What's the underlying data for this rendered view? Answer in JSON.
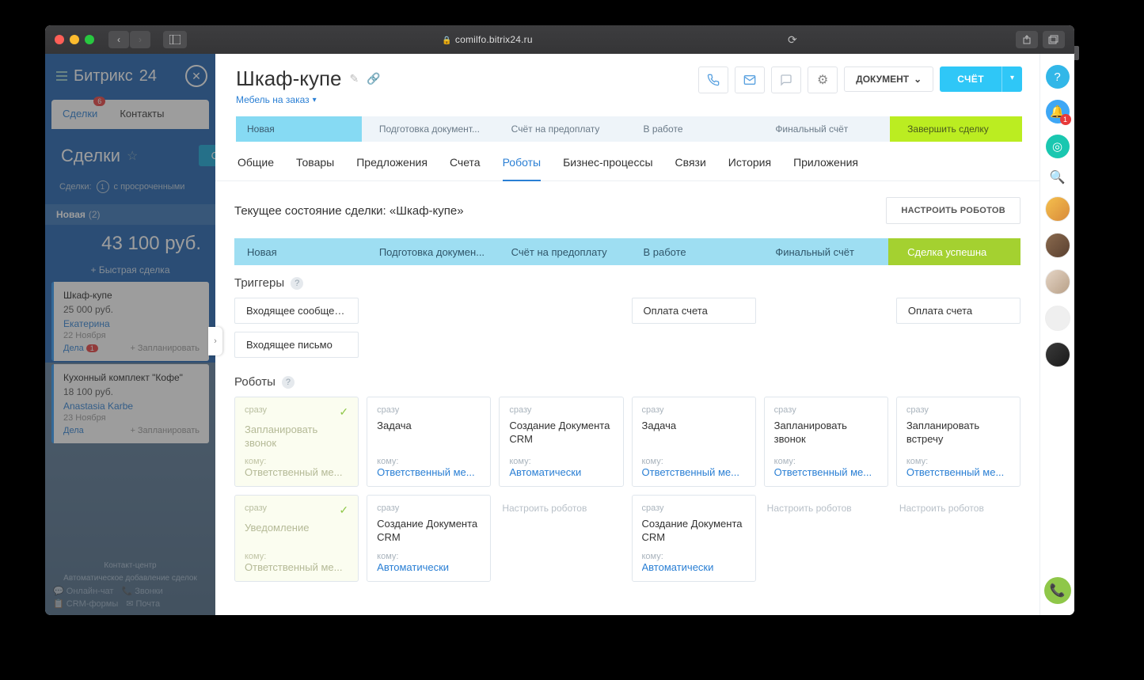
{
  "browser": {
    "url": "comilfo.bitrix24.ru"
  },
  "leftPane": {
    "logo1": "Битрикс",
    "logo2": "24",
    "tabs": [
      "Сделки",
      "Контакты"
    ],
    "tabBadge": "6",
    "sectionTitle": "Сделки",
    "filterPrefix": "Сделки:",
    "filterCount": "1",
    "filterText": "с просроченными",
    "stageName": "Новая",
    "stageCount": "(2)",
    "total": "43 100 руб.",
    "quickDeal": "Быстрая сделка",
    "deals": [
      {
        "title": "Шкаф-купе",
        "price": "25 000 руб.",
        "person": "Екатерина",
        "date": "22 Ноября",
        "dela": "Дела",
        "badge": "1",
        "plan": "+ Запланировать"
      },
      {
        "title": "Кухонный комплект \"Кофе\"",
        "price": "18 100 руб.",
        "person": "Anastasia Karbe",
        "date": "23 Ноября",
        "dela": "Дела",
        "badge": "",
        "plan": "+ Запланировать"
      }
    ],
    "cc1": "Контакт-центр",
    "cc2": "Автоматическое добавление сделок",
    "bl": [
      "Онлайн-чат",
      "Звонки",
      "CRM-формы",
      "Почта"
    ]
  },
  "header": {
    "title": "Шкаф-купе",
    "subtitle": "Мебель на заказ",
    "docBtn": "ДОКУМЕНТ",
    "billBtn": "СЧЁТ"
  },
  "pipeline": [
    "Новая",
    "Подготовка документ...",
    "Счёт на предоплату",
    "В работе",
    "Финальный счёт",
    "Завершить сделку"
  ],
  "tabs": [
    "Общие",
    "Товары",
    "Предложения",
    "Счета",
    "Роботы",
    "Бизнес-процессы",
    "Связи",
    "История",
    "Приложения"
  ],
  "activeTab": 4,
  "stateLabel": "Текущее состояние сделки: «Шкаф-купе»",
  "configureBtn": "НАСТРОИТЬ РОБОТОВ",
  "pipeline2": [
    "Новая",
    "Подготовка докумен...",
    "Счёт на предоплату",
    "В работе",
    "Финальный счёт",
    "Сделка успешна"
  ],
  "triggersLabel": "Триггеры",
  "triggers": [
    [
      "Входящее сообщени...",
      "Входящее письмо"
    ],
    [],
    [],
    [
      "Оплата счета"
    ],
    [],
    [
      "Оплата счета"
    ]
  ],
  "robotsLabel": "Роботы",
  "whenLabel": "сразу",
  "komuLabel": "кому:",
  "configureText": "Настроить роботов",
  "robots": [
    [
      {
        "done": true,
        "action": "Запланировать звонок",
        "resp": "Ответственный ме..."
      },
      {
        "done": true,
        "action": "Уведомление",
        "resp": "Ответственный ме..."
      }
    ],
    [
      {
        "done": false,
        "action": "Задача",
        "resp": "Ответственный ме..."
      },
      {
        "done": false,
        "action": "Создание Документа CRM",
        "resp": "Автоматически"
      }
    ],
    [
      {
        "done": false,
        "action": "Создание Документа CRM",
        "resp": "Автоматически"
      }
    ],
    [
      {
        "done": false,
        "action": "Задача",
        "resp": "Ответственный ме..."
      },
      {
        "done": false,
        "action": "Создание Документа CRM",
        "resp": "Автоматически"
      }
    ],
    [
      {
        "done": false,
        "action": "Запланировать звонок",
        "resp": "Ответственный ме..."
      }
    ],
    [
      {
        "done": false,
        "action": "Запланировать встречу",
        "resp": "Ответственный ме..."
      }
    ]
  ],
  "rail": {
    "notifBadge": "1"
  }
}
